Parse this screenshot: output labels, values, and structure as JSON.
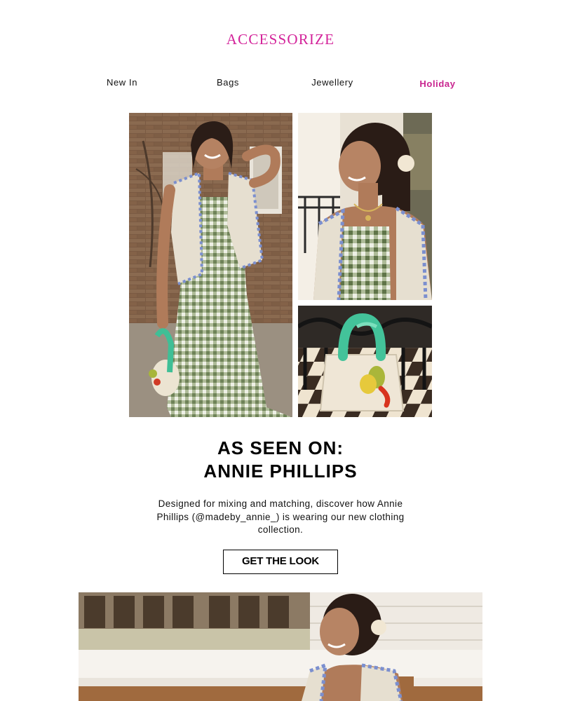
{
  "brand": {
    "logo_text": "ACCESSORIZE",
    "accent_color": "#d3239a"
  },
  "nav": {
    "items": [
      {
        "label": "New In"
      },
      {
        "label": "Bags"
      },
      {
        "label": "Jewellery"
      },
      {
        "label": "Holiday",
        "active": true
      }
    ]
  },
  "hero": {
    "headline": "AS SEEN ON:",
    "subheadline": "ANNIE PHILLIPS",
    "body": "Designed for mixing and matching, discover how Annie Phillips (@madeby_annie_) is wearing our new clothing collection.",
    "cta_label": "GET THE LOOK"
  },
  "images": {
    "main": "model-full-length-photo",
    "top_right": "model-portrait-photo",
    "bottom_right": "handbag-with-scarf-photo",
    "bottom_banner": "model-seated-photo"
  }
}
